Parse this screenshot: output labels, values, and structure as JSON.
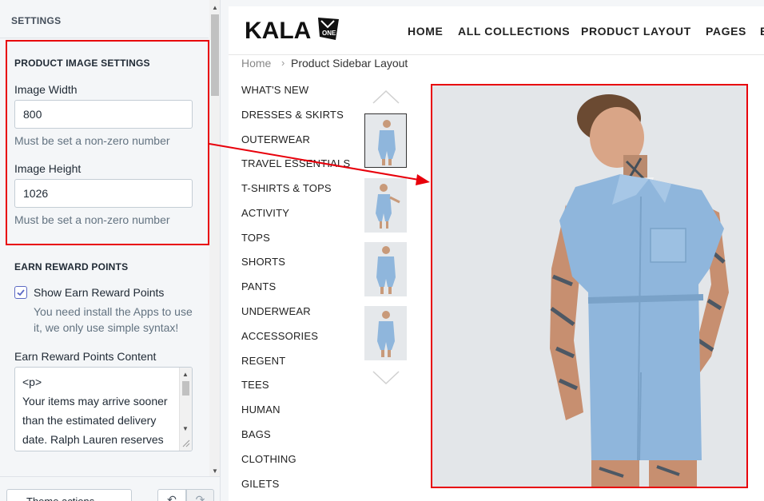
{
  "settings": {
    "title": "SETTINGS",
    "product_image": {
      "heading": "PRODUCT IMAGE SETTINGS",
      "width_label": "Image Width",
      "width_value": "800",
      "width_help": "Must be set a non-zero number",
      "height_label": "Image Height",
      "height_value": "1026",
      "height_help": "Must be set a non-zero number"
    },
    "reward": {
      "heading": "EARN REWARD POINTS",
      "checkbox_label": "Show Earn Reward Points",
      "checkbox_checked": true,
      "checkbox_help": "You need install the Apps to use it, we only use simple syntax!",
      "content_label": "Earn Reward Points Content",
      "content_value": "<p>\nYour items may arrive sooner than the estimated delivery date. Ralph Lauren reserves"
    },
    "bottom": {
      "theme_button": "Theme actions",
      "undo_icon": "undo-icon",
      "redo_icon": "redo-icon"
    }
  },
  "store": {
    "logo": "KALA",
    "logo_badge": "ONE",
    "nav": [
      "HOME",
      "ALL COLLECTIONS",
      "PRODUCT LAYOUT",
      "PAGES",
      "B"
    ],
    "breadcrumb": {
      "home": "Home",
      "separator": "›",
      "current": "Product Sidebar Layout"
    },
    "categories": [
      "WHAT'S NEW",
      "DRESSES & SKIRTS",
      "OUTERWEAR",
      "TRAVEL ESSENTIALS",
      "T-SHIRTS & TOPS",
      "ACTIVITY",
      "TOPS",
      "SHORTS",
      "PANTS",
      "UNDERWEAR",
      "ACCESSORIES",
      "REGENT",
      "TEES",
      "HUMAN",
      "BAGS",
      "CLOTHING",
      "GILETS"
    ],
    "thumbnails_count": 4,
    "active_thumbnail": 0,
    "colors": {
      "annotation": "#e8000b",
      "denim": "#8fb6dc",
      "accent": "#5c6ac4"
    }
  }
}
